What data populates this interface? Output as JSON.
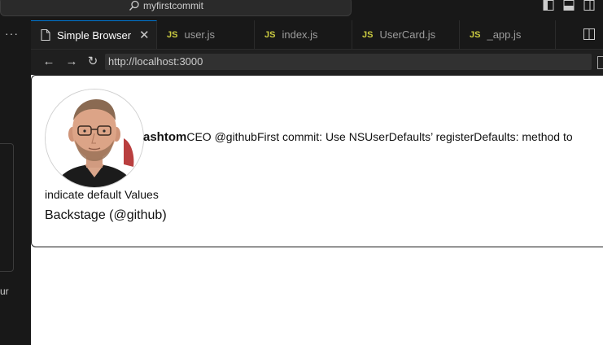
{
  "window": {
    "search_text": "myfirstcommit"
  },
  "tabs": [
    {
      "label": "Simple Browser",
      "kind": "browser",
      "active": true
    },
    {
      "label": "user.js",
      "kind": "js",
      "active": false
    },
    {
      "label": "index.js",
      "kind": "js",
      "active": false
    },
    {
      "label": "UserCard.js",
      "kind": "js",
      "active": false
    },
    {
      "label": "_app.js",
      "kind": "js",
      "active": false
    }
  ],
  "tab_icon_js": "JS",
  "sidebar": {
    "more_label": "···",
    "fragment_text": "ur"
  },
  "browser": {
    "url": "http://localhost:3000"
  },
  "page": {
    "username": "ashtom",
    "bio": "CEO @github",
    "commit_prefix": "First commit: ",
    "commit_message_part1": "Use NSUserDefaults’ registerDefaults: method to",
    "commit_message_part2": "indicate default Values",
    "company": "Backstage (@github)"
  },
  "colors": {
    "accent": "#0078d4",
    "js_icon": "#cbcb41",
    "editor_bg": "#1f1f1f",
    "page_bg": "#ffffff"
  }
}
